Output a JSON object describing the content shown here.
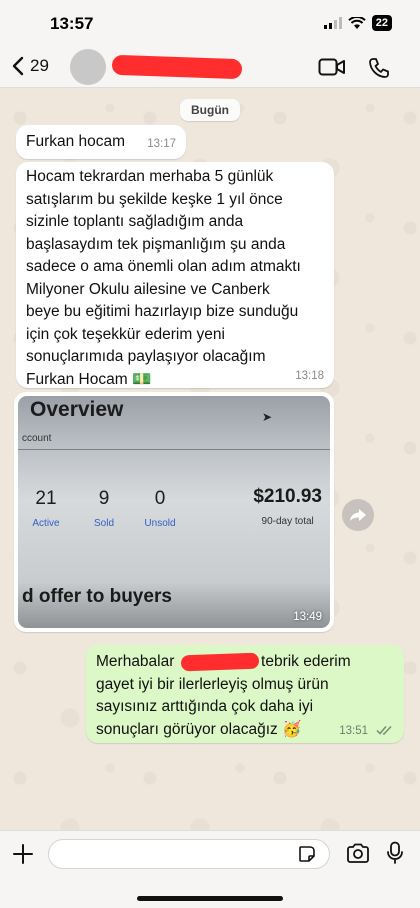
{
  "status_bar": {
    "time": "13:57",
    "battery": "22"
  },
  "header": {
    "back_count": "29"
  },
  "date_chip": "Bugün",
  "messages": [
    {
      "text": "Furkan hocam",
      "time": "13:17"
    },
    {
      "text": "Hocam tekrardan merhaba 5 günlük\nsatışlarım bu şekilde keşke 1 yıl önce\nsizinle toplantı sağladığım anda\nbaşlasaydım tek pişmanlığım şu anda\nsadece o ama önemli olan adım atmaktı\nMilyoner Okulu ailesine ve Canberk\nbeye bu eğitimi hazırlayıp bize sunduğu\niçin  çok teşekkür ederim yeni\nsonuçlarımıda paylaşıyor olacağım\nFurkan Hocam 💵",
      "time": "13:18"
    }
  ],
  "image_message": {
    "title": "Overview",
    "subtitle": "ccount",
    "stats": [
      {
        "value": "21",
        "label": "Active"
      },
      {
        "value": "9",
        "label": "Sold"
      },
      {
        "value": "0",
        "label": "Unsold"
      }
    ],
    "total_value": "$210.93",
    "total_label": "90-day total",
    "offer_text": "d offer to buyers",
    "time": "13:49"
  },
  "outgoing": {
    "line1_a": "Merhabalar ",
    "line1_b": " tebrik ederim",
    "rest": "gayet iyi bir ilerlerleyiş olmuş ürün\nsayısınız arttığında çok daha iyi\nsonuçları görüyor olacağız 🥳",
    "time": "13:51"
  },
  "colors": {
    "outgoing_bubble": "#dcf8c6",
    "incoming_bubble": "#ffffff",
    "link_blue": "#2f5fc7",
    "redaction": "#ff2d2d"
  },
  "icons": [
    "back-chevron-icon",
    "video-call-icon",
    "phone-icon",
    "forward-icon",
    "plus-icon",
    "sticker-icon",
    "camera-icon",
    "mic-icon",
    "double-check-icon"
  ]
}
